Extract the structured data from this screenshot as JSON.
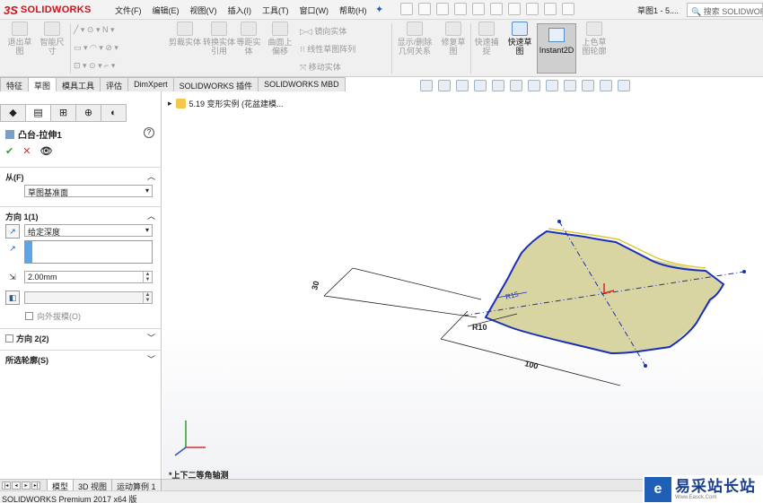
{
  "app": {
    "logo_ds": "3S",
    "logo_text": "SOLIDWORKS",
    "menus": [
      "文件(F)",
      "编辑(E)",
      "视图(V)",
      "插入(I)",
      "工具(T)",
      "窗口(W)",
      "帮助(H)"
    ],
    "doc_title": "草图1 - 5....",
    "search_placeholder": "搜索 SOLIDWORKS"
  },
  "ribbon": {
    "exit_sketch": "退出草图",
    "smart_dim": "智能尺寸",
    "mirror_entities": "镜向实体",
    "linear_pattern": "线性草图阵列",
    "move_entities": "移动实体",
    "trim": "剪裁实体",
    "convert": "转换实体引用",
    "offset": "等距实体",
    "surface_offset": "曲面上偏移",
    "display_relations": "显示/删除几何关系",
    "repair_sketch": "修复草图",
    "quick_snaps": "快速捕捉",
    "rapid_sketch": "快速草图",
    "instant2d": "Instant2D",
    "shaded_sketch": "上色草图轮廓"
  },
  "tabs": [
    "特征",
    "草图",
    "模具工具",
    "评估",
    "DimXpert",
    "SOLIDWORKS 插件",
    "SOLIDWORKS MBD"
  ],
  "pm": {
    "title": "凸台-拉伸1",
    "ok": "✔",
    "cancel": "✕",
    "preview": "👁",
    "from_label": "从(F)",
    "from_value": "草图基准面",
    "dir1_label": "方向 1(1)",
    "dir1_type": "给定深度",
    "depth": "2.00mm",
    "draft_outward": "向外拔模(O)",
    "dir2_label": "方向 2(2)",
    "contours_label": "所选轮廓(S)"
  },
  "graphics": {
    "tree_item": "5.19 变形实例 (花盆建模...",
    "view_label": "*上下二等角轴测",
    "dim_100": "100",
    "dim_r10": "R10",
    "dim_r15": "R15",
    "dim_30": "30"
  },
  "bottom_tabs": [
    "模型",
    "3D 视图",
    "运动算例 1"
  ],
  "status": "SOLIDWORKS Premium 2017 x64 版",
  "watermark": {
    "name": "易采站长站",
    "url": "Www.Easck.Com"
  },
  "colors": {
    "sketch_blue": "#1a2fb8",
    "face_fill": "#d9d5a3",
    "brand_red": "#d40f1b"
  }
}
